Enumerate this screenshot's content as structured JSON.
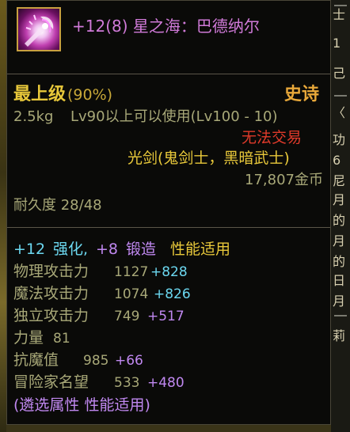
{
  "item": {
    "title": "+12(8) 星之海：巴德纳尔",
    "grade": "最上级",
    "grade_percent": "(90%)",
    "rarity": "史诗",
    "weight": "2.5kg",
    "level_requirement": "Lv90以上可以使用(Lv100 - 10)",
    "trade_status": "无法交易",
    "weapon_type": "光剑(鬼剑士，黑暗武士)",
    "price": "17,807金币",
    "durability": "耐久度 28/48"
  },
  "enhancement": {
    "enhance_value": "+12",
    "enhance_label": "强化,",
    "forge_value": "+8",
    "forge_label": "锻造",
    "performance_label": "性能适用"
  },
  "stats": [
    {
      "label": "物理攻击力",
      "value": "1127",
      "bonus": "+828",
      "bonus_color": "#6cd8f0"
    },
    {
      "label": "魔法攻击力",
      "value": "1074",
      "bonus": "+826",
      "bonus_color": "#6cd8f0"
    },
    {
      "label": "独立攻击力",
      "value": "749",
      "bonus": "+517",
      "bonus_color": "#c088f0"
    },
    {
      "label": "力量",
      "value": "81",
      "bonus": "",
      "bonus_color": ""
    },
    {
      "label": "抗魔值",
      "value": "985",
      "bonus": "+66",
      "bonus_color": "#c088f0"
    },
    {
      "label": "冒险家名望",
      "value": "533",
      "bonus": "+480",
      "bonus_color": "#c088f0"
    }
  ],
  "footer": "(遴选属性 性能适用)",
  "colors": {
    "title": "#d07ad8",
    "grade": "#e8c83a",
    "rarity": "#e8a83a",
    "trade": "#e03a2a",
    "muted": "#a8a878",
    "cyan": "#6cd8f0",
    "purple": "#c088f0"
  },
  "icon": "star-sea-sword-icon",
  "side_panel": {
    "glyphs": [
      "士",
      "1",
      "己",
      "〈",
      "功",
      "6",
      "尼",
      "月",
      "的",
      "月",
      "的",
      "日",
      "月",
      "莉"
    ]
  }
}
